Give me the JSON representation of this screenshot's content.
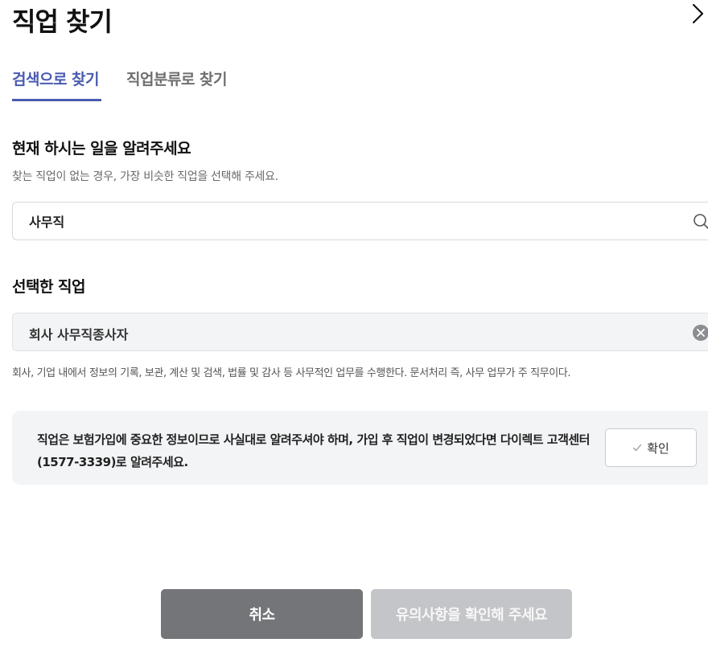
{
  "header": {
    "title": "직업 찾기",
    "close_icon": "chevron-right-icon"
  },
  "tabs": [
    {
      "label": "검색으로 찾기",
      "active": true
    },
    {
      "label": "직업분류로 찾기",
      "active": false
    }
  ],
  "search_section": {
    "heading": "현재 하시는 일을 알려주세요",
    "hint": "찾는 직업이 없는 경우, 가장 비슷한 직업을 선택해 주세요.",
    "input_value": "사무직",
    "icon": "search-icon"
  },
  "selected_section": {
    "heading": "선택한 직업",
    "value": "회사 사무직종사자",
    "clear_icon": "clear-icon",
    "description": "회사, 기업 내에서 정보의 기록, 보관, 계산 및 검색, 법률 및 감사 등 사무적인 업무를 수행한다. 문서처리 즉, 사무 업무가 주 직무이다."
  },
  "notice": {
    "text": "직업은 보험가입에 중요한 정보이므로 사실대로 알려주셔야 하며, 가입 후 직업이 변경되었다면 다이렉트 고객센터(1577-3339)로 알려주세요.",
    "confirm_label": "확인",
    "confirm_icon": "check-icon"
  },
  "footer": {
    "cancel_label": "취소",
    "submit_label": "유의사항을 확인해 주세요"
  },
  "colors": {
    "accent": "#4a5bb0",
    "cancel_bg": "#747579",
    "submit_disabled_bg": "#c4c5c8",
    "panel_bg": "#f3f4f6"
  }
}
